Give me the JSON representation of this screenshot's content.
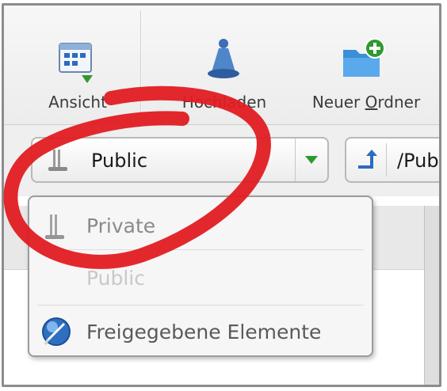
{
  "toolbar": {
    "view_button": {
      "label": "Ansicht",
      "icon": "view-grid-icon"
    },
    "upload_button": {
      "label": "Hochladen",
      "icon": "upload-icon"
    },
    "new_folder_button": {
      "label_before": "Neuer ",
      "label_underlined": "O",
      "label_after": "rdner",
      "icon": "new-folder-icon"
    }
  },
  "location": {
    "selected": "Public",
    "selected_icon": "drive-icon",
    "path": "/Pub",
    "path_icon": "up-arrow-icon"
  },
  "dropdown": {
    "items": [
      {
        "label": "Private",
        "icon": "drive-icon",
        "color": "#8a8a8a"
      },
      {
        "label": "Public",
        "icon": "drive-icon",
        "color": "#c8c8c8"
      },
      {
        "label": "Freigegebene Elemente",
        "icon": "shared-items-icon",
        "color": "#5a5a5a"
      }
    ]
  },
  "colors": {
    "accent_green": "#2e9a2e",
    "annotation_red": "#e01c22",
    "folder_blue": "#3b8fd6"
  }
}
